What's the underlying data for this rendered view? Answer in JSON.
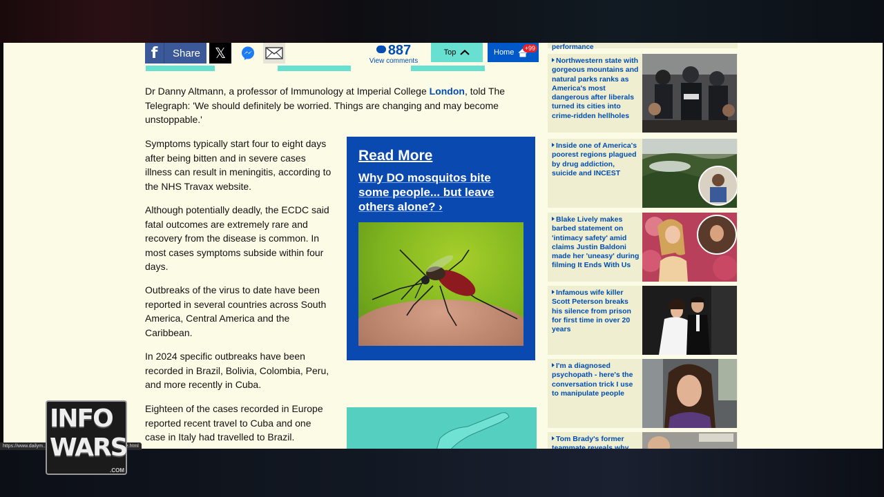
{
  "share_bar": {
    "share_label": "Share",
    "comment_count": "887",
    "comments_label": "View comments",
    "top_label": "Top",
    "home_label": "Home",
    "home_badge": "+99",
    "colors": {
      "facebook": "#3b5998",
      "top": "#67e0d2",
      "home": "#0058c9",
      "link": "#004db3"
    }
  },
  "article": {
    "lead_before": "Dr Danny Altmann, a professor of Immunology at Imperial College ",
    "lead_link": "London",
    "lead_after": ", told The Telegraph: 'We should definitely be worried. Things are changing and may become unstoppable.'",
    "paragraphs": [
      "Symptoms typically start four to eight days after being bitten and in severe cases illness can result in meningitis, according to the NHS Travax website.",
      "Although potentially deadly, the ECDC said fatal outcomes are extremely rare and recovery from the disease is common. In most cases symptoms subside within four days.",
      "Outbreaks of the virus to date have been reported in several countries across South America, Central America and the Caribbean.",
      "In 2024 specific outbreaks have been recorded in Brazil, Bolivia, Colombia, Peru, and more recently in Cuba.",
      "Eighteen of the cases recorded in Europe reported recent travel to Cuba and one case in Italy had travelled to Brazil."
    ]
  },
  "read_more": {
    "title": "Read More",
    "headline": "Why DO mosquitos bite some people... but leave others alone? ›"
  },
  "sidebar": {
    "top_fragment": "performance",
    "stories": [
      {
        "text": "Northwestern state with gorgeous mountains and natural parks ranks as America's most dangerous after liberals turned its cities into crime-ridden hellholes",
        "image": "police-crowd-photo"
      },
      {
        "text": "Inside one of America's poorest regions plagued by drug addiction, suicide and INCEST",
        "image": "foggy-mountains-photo"
      },
      {
        "text": "Blake Lively makes barbed statement on 'intimacy safety' amid claims Justin Baldoni made her 'uneasy' during filming It Ends With Us",
        "image": "blake-lively-photo"
      },
      {
        "text": "Infamous wife killer Scott Peterson breaks his silence from prison for first time in over 20 years",
        "image": "wedding-couple-photo"
      },
      {
        "text": "I'm a diagnosed psychopath - here's the conversation trick I use to manipulate people",
        "image": "woman-in-car-photo"
      },
      {
        "text": "Tom Brady's former teammate reveals why",
        "image": "tom-brady-photo"
      }
    ]
  },
  "status_url": "https://www.dailym... /dengue-fever-Europe-mosquitos-bite.html",
  "logo": {
    "line1": "INFO",
    "line2": "WARS",
    "line3": ".COM"
  }
}
